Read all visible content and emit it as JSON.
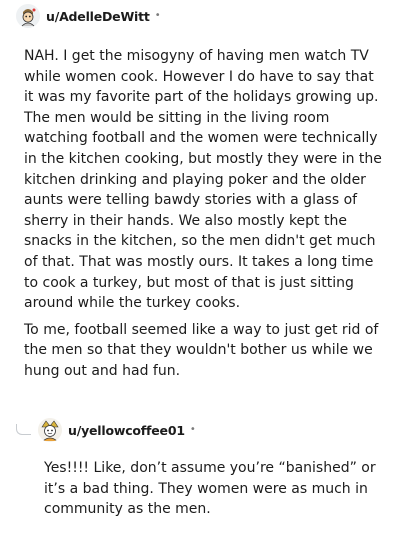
{
  "comment": {
    "username": "u/AdelleDeWitt",
    "separator": "•",
    "avatar_icon": "snoo-avatar-icon",
    "paragraphs": [
      "NAH. I get the misogyny of having men watch TV while women cook. However I do have to say that it was my favorite part of the holidays growing up. The men would be sitting in the living room watching football and the women were technically in the kitchen cooking, but mostly they were in the kitchen drinking and playing poker and the older aunts were telling bawdy stories with a glass of sherry in their hands. We also mostly kept the snacks in the kitchen, so the men didn't get much of that. That was mostly ours. It takes a long time to cook a turkey, but most of that is just sitting around while the turkey cooks.",
      "To me, football seemed like a way to just get rid of the men so that they wouldn't bother us while we hung out and had fun."
    ]
  },
  "reply": {
    "username": "u/yellowcoffee01",
    "separator": "•",
    "avatar_icon": "snoo-avatar-icon",
    "connector_icon": "reply-thread-icon",
    "paragraphs": [
      "Yes!!!! Like, don’t assume you’re “banished” or it’s a bad thing. They women were as much in community as the men."
    ]
  }
}
